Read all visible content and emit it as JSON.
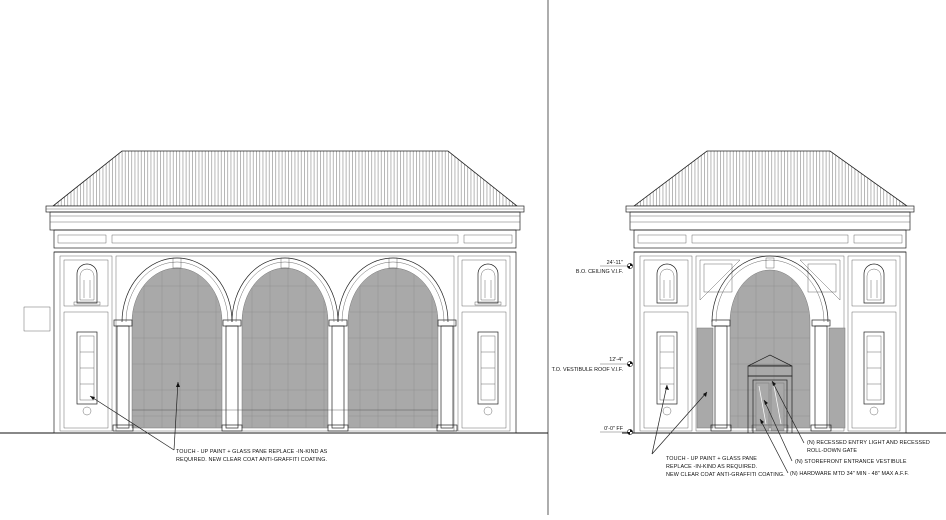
{
  "sheet": {
    "left_elevation": {
      "note_line1": "TOUCH - UP PAINT + GLASS PANE REPLACE -IN-KIND AS",
      "note_line2": "REQUIRED. NEW CLEAR COAT ANTI-GRAFFITI COATING."
    },
    "right_elevation": {
      "levels": [
        {
          "elevation": "24'-11\"",
          "name": "B.O. CEILING V.I.F."
        },
        {
          "elevation": "12'-4\"",
          "name": "T.O. VESTIBULE ROOF V.I.F."
        },
        {
          "elevation": "0'-0\" FF",
          "name": ""
        }
      ],
      "note_touchup_line1": "TOUCH - UP PAINT + GLASS PANE",
      "note_touchup_line2": "REPLACE -IN-KIND AS REQUIRED.",
      "note_touchup_line3": "NEW CLEAR COAT ANTI-GRAFFITI COATING.",
      "callout_gate_line1": "(N) RECESSED  ENTRY LIGHT AND RECESSED",
      "callout_gate_line2": "ROLL-DOWN GATE",
      "callout_vestibule": "(N) STOREFRONT ENTRANCE VESTIBULE",
      "callout_hardware": "(N) HARDWARE MTD 34\" MIN - 48\" MAX A.F.F."
    }
  }
}
